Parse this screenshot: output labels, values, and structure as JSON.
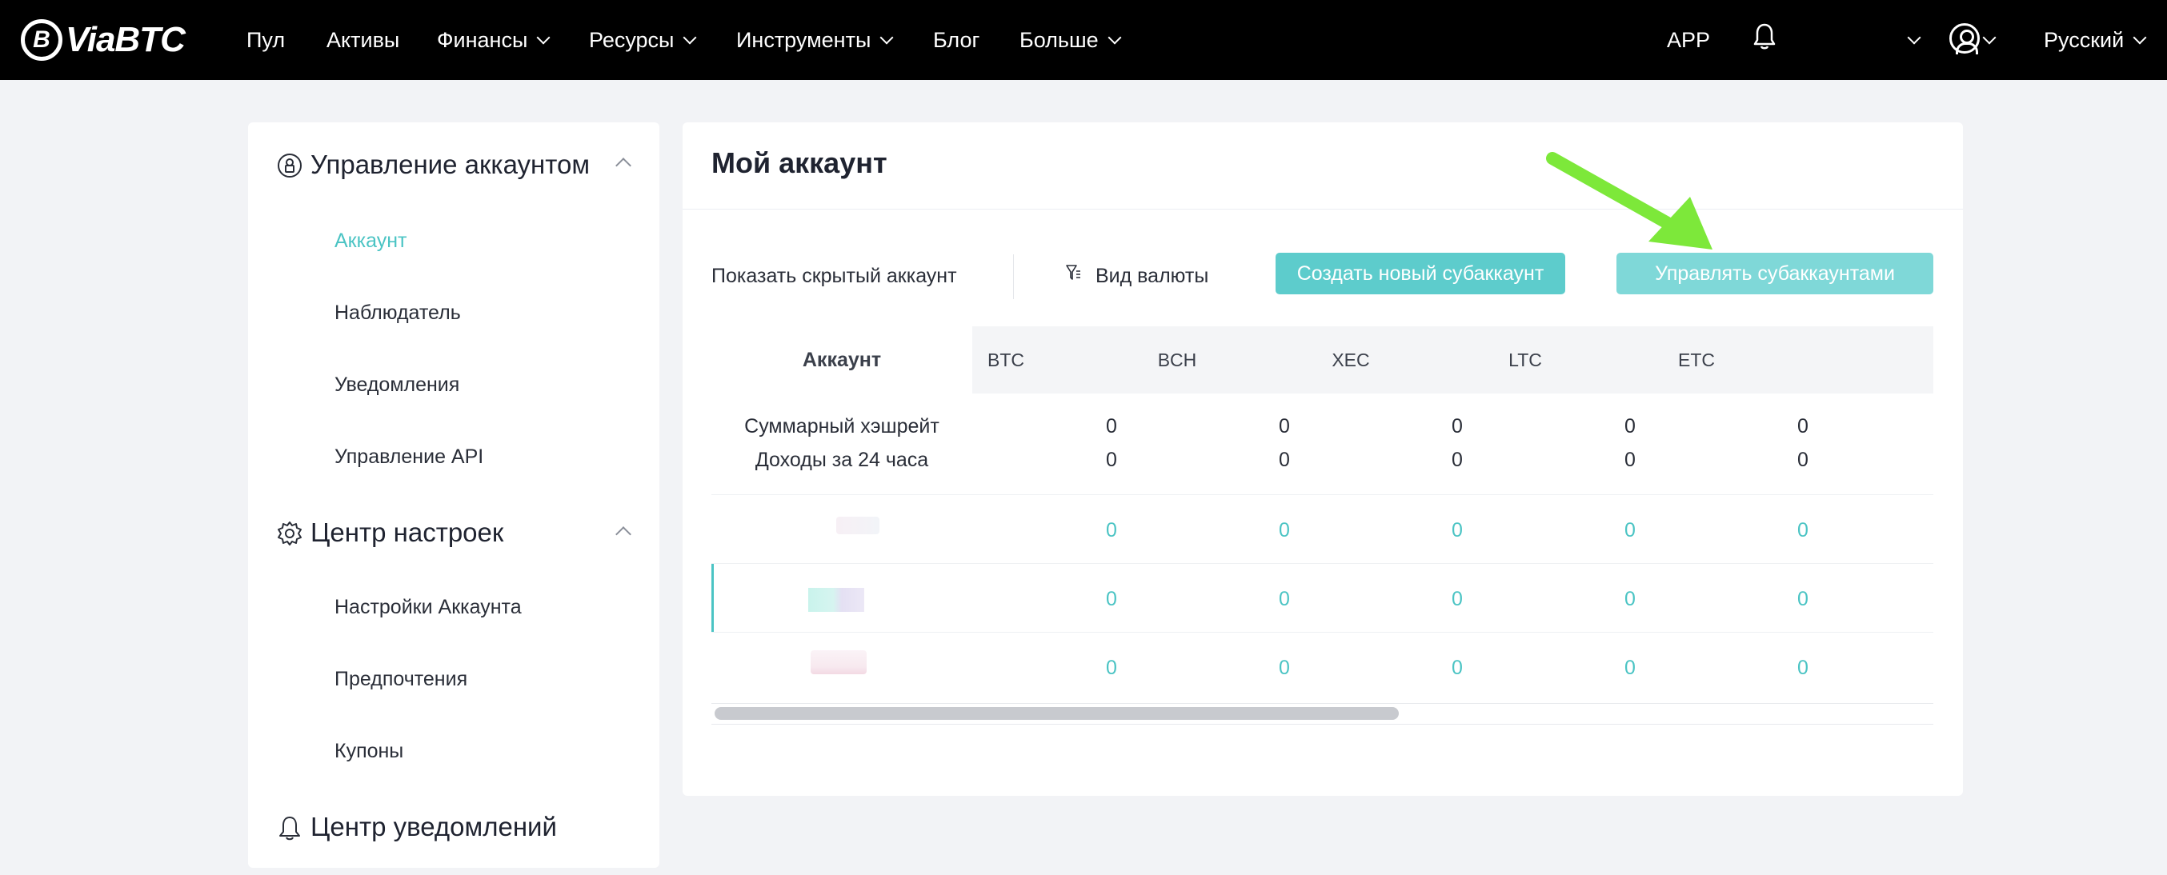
{
  "brand": {
    "name": "ViaBTC"
  },
  "nav": {
    "items": [
      {
        "label": "Пул",
        "dropdown": false
      },
      {
        "label": "Активы",
        "dropdown": false
      },
      {
        "label": "Финансы",
        "dropdown": true
      },
      {
        "label": "Ресурсы",
        "dropdown": true
      },
      {
        "label": "Инструменты",
        "dropdown": true
      },
      {
        "label": "Блог",
        "dropdown": false
      },
      {
        "label": "Больше",
        "dropdown": true
      }
    ],
    "app_label": "APP",
    "language": "Русский"
  },
  "sidebar": {
    "sections": [
      {
        "title": "Управление аккаунтом",
        "icon": "account-shield-icon",
        "expanded": true,
        "items": [
          {
            "label": "Аккаунт",
            "active": true
          },
          {
            "label": "Наблюдатель",
            "active": false
          },
          {
            "label": "Уведомления",
            "active": false
          },
          {
            "label": "Управление API",
            "active": false
          }
        ]
      },
      {
        "title": "Центр настроек",
        "icon": "gear-icon",
        "expanded": true,
        "items": [
          {
            "label": "Настройки Аккаунта",
            "active": false
          },
          {
            "label": "Предпочтения",
            "active": false
          },
          {
            "label": "Купоны",
            "active": false
          }
        ]
      },
      {
        "title": "Центр уведомлений",
        "icon": "bell-icon",
        "expanded": false,
        "items": []
      }
    ]
  },
  "main": {
    "title": "Мой аккаунт",
    "toolbar": {
      "show_hidden": "Показать скрытый аккаунт",
      "currency_view": "Вид валюты",
      "create_button": "Создать новый субаккаунт",
      "manage_button": "Управлять субаккаунтами"
    },
    "table": {
      "account_header": "Аккаунт",
      "columns": [
        "BTC",
        "BCH",
        "XEC",
        "LTC",
        "ETC"
      ],
      "summary": {
        "hashrate_label": "Суммарный хэшрейт",
        "income_label": "Доходы за 24 часа",
        "hashrate": [
          "0",
          "0",
          "0",
          "0",
          "0"
        ],
        "income": [
          "0",
          "0",
          "0",
          "0",
          "0"
        ]
      },
      "rows": [
        {
          "values": [
            "0",
            "0",
            "0",
            "0",
            "0"
          ]
        },
        {
          "values": [
            "0",
            "0",
            "0",
            "0",
            "0"
          ]
        },
        {
          "values": [
            "0",
            "0",
            "0",
            "0",
            "0"
          ]
        }
      ]
    }
  },
  "colors": {
    "accent": "#4bc4c4",
    "button_primary": "#5dcccc",
    "button_secondary": "#7fd8d8",
    "annotation_arrow": "#7de83a",
    "topbar": "#000000"
  }
}
